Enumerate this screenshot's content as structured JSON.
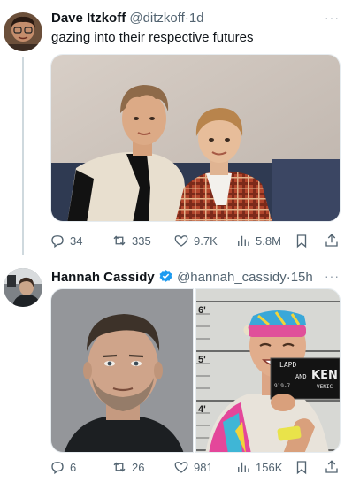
{
  "tweets": [
    {
      "author": "Dave Itzkoff",
      "handle": "@ditzkoff",
      "separator": "·",
      "time": "1d",
      "text": "gazing into their respective futures",
      "more": "···",
      "stats": {
        "replies": "34",
        "retweets": "335",
        "likes": "9.7K",
        "views": "5.8M"
      }
    },
    {
      "author": "Hannah Cassidy",
      "handle": "@hannah_cassidy",
      "separator": "·",
      "time": "15h",
      "more": "···",
      "stats": {
        "replies": "6",
        "retweets": "26",
        "likes": "981",
        "views": "156K"
      }
    }
  ],
  "mugshot_sign": {
    "line1": "LAPD",
    "line2": "AND",
    "line3": "KEN",
    "line4": "VENIC",
    "number": "919-7"
  },
  "height_marks": [
    "6'",
    "5'",
    "4'"
  ],
  "colors": {
    "verified": "#1d9bf0",
    "icon": "#536471",
    "text": "#0f1419",
    "thread": "#cfd9de"
  }
}
